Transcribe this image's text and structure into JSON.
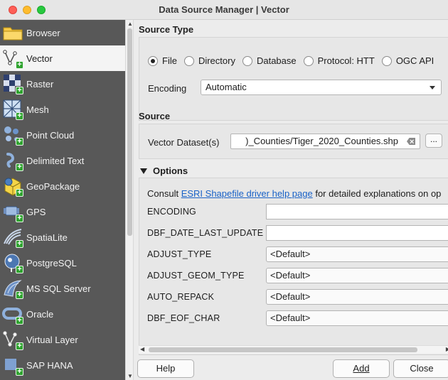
{
  "window": {
    "title": "Data Source Manager | Vector"
  },
  "sidebar": {
    "items": [
      {
        "label": "Browser",
        "icon": "folder-icon"
      },
      {
        "label": "Vector",
        "icon": "vector-icon",
        "active": true
      },
      {
        "label": "Raster",
        "icon": "raster-icon"
      },
      {
        "label": "Mesh",
        "icon": "mesh-icon"
      },
      {
        "label": "Point Cloud",
        "icon": "point-cloud-icon"
      },
      {
        "label": "Delimited Text",
        "icon": "delimited-text-icon"
      },
      {
        "label": "GeoPackage",
        "icon": "geopackage-icon"
      },
      {
        "label": "GPS",
        "icon": "gps-icon"
      },
      {
        "label": "SpatiaLite",
        "icon": "spatialite-icon"
      },
      {
        "label": "PostgreSQL",
        "icon": "postgresql-icon"
      },
      {
        "label": "MS SQL Server",
        "icon": "mssql-icon"
      },
      {
        "label": "Oracle",
        "icon": "oracle-icon"
      },
      {
        "label": "Virtual Layer",
        "icon": "virtual-layer-icon"
      },
      {
        "label": "SAP HANA",
        "icon": "sap-hana-icon"
      }
    ]
  },
  "source_type": {
    "heading": "Source Type",
    "options": [
      "File",
      "Directory",
      "Database",
      "Protocol: HTT",
      "OGC API"
    ],
    "selected": "File",
    "encoding_label": "Encoding",
    "encoding_value": "Automatic"
  },
  "source": {
    "heading": "Source",
    "dataset_label": "Vector Dataset(s)",
    "dataset_value": ")_Counties/Tiger_2020_Counties.shp",
    "browse_label": "..."
  },
  "options": {
    "heading": "Options",
    "consult_prefix": "Consult ",
    "consult_link": "ESRI Shapefile driver help page",
    "consult_suffix": " for detailed explanations on op",
    "rows": [
      {
        "label": "ENCODING",
        "kind": "text",
        "value": ""
      },
      {
        "label": "DBF_DATE_LAST_UPDATE",
        "kind": "text",
        "value": ""
      },
      {
        "label": "ADJUST_TYPE",
        "kind": "combo",
        "value": "<Default>"
      },
      {
        "label": "ADJUST_GEOM_TYPE",
        "kind": "combo",
        "value": "<Default>"
      },
      {
        "label": "AUTO_REPACK",
        "kind": "combo",
        "value": "<Default>"
      },
      {
        "label": "DBF_EOF_CHAR",
        "kind": "combo",
        "value": "<Default>"
      }
    ]
  },
  "buttons": {
    "help": "Help",
    "add": "Add",
    "close": "Close"
  },
  "colors": {
    "sidebar_bg": "#585858",
    "link": "#1a62c7",
    "plus_badge": "#2fa32f"
  }
}
